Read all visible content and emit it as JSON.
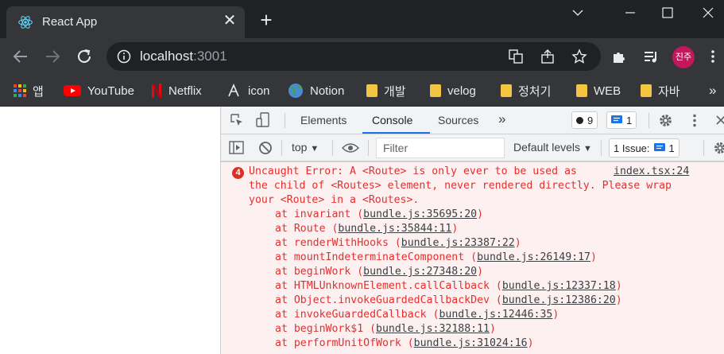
{
  "browser": {
    "tab_title": "React App",
    "tab_close": "✕",
    "new_tab": "+",
    "url_host": "localhost",
    "url_port": ":3001",
    "avatar_text": "진주"
  },
  "bookmarks": [
    {
      "label": "앱",
      "icon": "apps-grid-icon"
    },
    {
      "label": "YouTube",
      "icon": "youtube-icon"
    },
    {
      "label": "Netflix",
      "icon": "netflix-icon"
    },
    {
      "label": "icon",
      "icon": "icon-site-icon"
    },
    {
      "label": "Notion",
      "icon": "globe-icon"
    },
    {
      "label": "개발",
      "icon": "folder-icon"
    },
    {
      "label": "velog",
      "icon": "folder-icon"
    },
    {
      "label": "정처기",
      "icon": "folder-icon"
    },
    {
      "label": "WEB",
      "icon": "folder-icon"
    },
    {
      "label": "자바",
      "icon": "folder-icon"
    }
  ],
  "bookmarks_more": "»",
  "devtools": {
    "tabs": [
      "Elements",
      "Console",
      "Sources"
    ],
    "active_tab": "Console",
    "more_tabs": "»",
    "error_badge": "9",
    "message_badge": "1",
    "context": "top",
    "filter_placeholder": "Filter",
    "levels": "Default levels",
    "issues_label": "1 Issue:",
    "issues_count": "1"
  },
  "console": {
    "error_count": "4",
    "message_lines": [
      "Uncaught Error: A <Route> is only ever to be used as",
      "the child of <Routes> element, never rendered directly. Please wrap",
      "your <Route> in a <Routes>."
    ],
    "source": "index.tsx:24",
    "stack": [
      {
        "fn": "at invariant (",
        "loc": "bundle.js:35695:20",
        "end": ")"
      },
      {
        "fn": "at Route (",
        "loc": "bundle.js:35844:11",
        "end": ")"
      },
      {
        "fn": "at renderWithHooks (",
        "loc": "bundle.js:23387:22",
        "end": ")"
      },
      {
        "fn": "at mountIndeterminateComponent (",
        "loc": "bundle.js:26149:17",
        "end": ")"
      },
      {
        "fn": "at beginWork (",
        "loc": "bundle.js:27348:20",
        "end": ")"
      },
      {
        "fn": "at HTMLUnknownElement.callCallback (",
        "loc": "bundle.js:12337:18",
        "end": ")"
      },
      {
        "fn": "at Object.invokeGuardedCallbackDev (",
        "loc": "bundle.js:12386:20",
        "end": ")"
      },
      {
        "fn": "at invokeGuardedCallback (",
        "loc": "bundle.js:12446:35",
        "end": ")"
      },
      {
        "fn": "at beginWork$1 (",
        "loc": "bundle.js:32188:11",
        "end": ")"
      },
      {
        "fn": "at performUnitOfWork (",
        "loc": "bundle.js:31024:16",
        "end": ")"
      }
    ]
  },
  "colors": {
    "error_red": "#e0312f",
    "accent_blue": "#1a73e8",
    "chrome_dark": "#202124"
  }
}
